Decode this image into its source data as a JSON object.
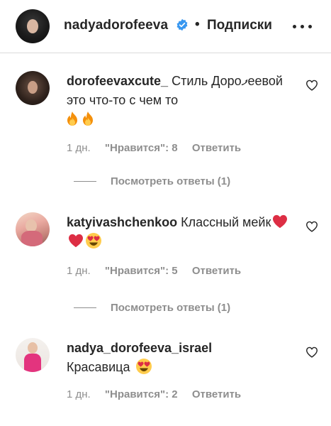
{
  "header": {
    "username": "nadyadorofeeva",
    "separator": "•",
    "follow_label": "Подписки",
    "icons": {
      "verified": "verified-badge-icon",
      "more": "more-options-icon"
    },
    "colors": {
      "verified": "#3897f0"
    }
  },
  "comments": [
    {
      "username": "dorofeevaxcute_",
      "text": "Стиль Дороފеевой это что-то с чем то",
      "emojis": [
        "fire",
        "fire"
      ],
      "time": "1 дн.",
      "likes": "\"Нравится\": 8",
      "reply": "Ответить",
      "view_replies": "Посмотреть ответы (1)"
    },
    {
      "username": "katyivashchenkoo",
      "text": "Классный мейк",
      "emojis": [
        "red-heart",
        "red-heart",
        "heart-eyes"
      ],
      "time": "1 дн.",
      "likes": "\"Нравится\": 5",
      "reply": "Ответить",
      "view_replies": "Посмотреть ответы (1)"
    },
    {
      "username": "nadya_dorofeeva_israel",
      "text": "Красавица",
      "emojis": [
        "heart-eyes"
      ],
      "time": "1 дн.",
      "likes": "\"Нравится\": 2",
      "reply": "Ответить"
    }
  ]
}
